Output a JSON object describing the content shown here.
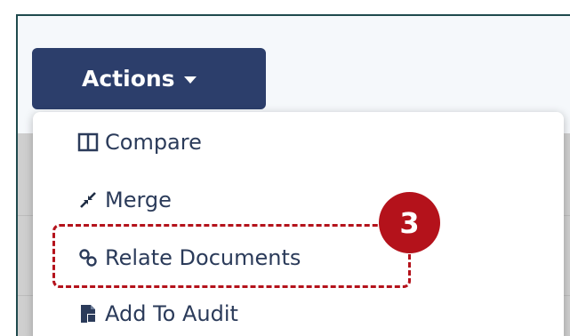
{
  "actions_button": {
    "label": "Actions"
  },
  "menu": {
    "items": [
      {
        "label": "Compare",
        "icon": "columns-icon"
      },
      {
        "label": "Merge",
        "icon": "merge-arrows-icon"
      },
      {
        "label": "Relate Documents",
        "icon": "link-icon"
      },
      {
        "label": "Add To Audit",
        "icon": "clipboard-add-icon"
      }
    ]
  },
  "annotation": {
    "step_number": "3"
  },
  "colors": {
    "button_bg": "#2c3e6b",
    "menu_text": "#2b3b5a",
    "annotation_red": "#b4121b"
  }
}
